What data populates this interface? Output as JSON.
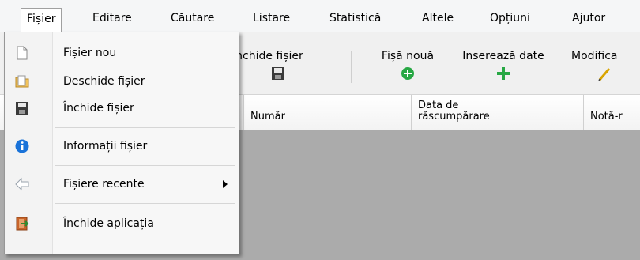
{
  "menubar": {
    "items": [
      {
        "label": "Fișier",
        "active": true
      },
      {
        "label": "Editare"
      },
      {
        "label": "Căutare"
      },
      {
        "label": "Listare"
      },
      {
        "label": "Statistică"
      },
      {
        "label": "Altele"
      },
      {
        "label": "Opțiuni"
      },
      {
        "label": "Ajutor"
      }
    ]
  },
  "toolbar": {
    "close_file_label": "Închide fișier",
    "new_record_label": "Fișă nouă",
    "insert_data_label": "Inserează date",
    "modify_label": "Modifica"
  },
  "grid": {
    "columns": [
      {
        "label": "Număr"
      },
      {
        "label": "Data de răscumpărare",
        "line1": "Data de",
        "line2": "răscumpărare"
      },
      {
        "label": "Notă-r"
      }
    ]
  },
  "file_menu": {
    "items": [
      {
        "label": "Fișier nou",
        "icon": "new-file-icon"
      },
      {
        "label": "Deschide fișier",
        "icon": "open-folder-icon"
      },
      {
        "label": "Închide fișier",
        "icon": "floppy-disk-icon"
      },
      {
        "label": "Informații fișier",
        "icon": "info-icon"
      },
      {
        "label": "Fișiere recente",
        "icon": "back-arrow-icon",
        "has_submenu": true
      },
      {
        "label": "Închide aplicația",
        "icon": "exit-door-icon"
      }
    ]
  },
  "colors": {
    "info_blue": "#1a73d9",
    "add_green": "#27a844",
    "grid_bg": "#ababab"
  }
}
